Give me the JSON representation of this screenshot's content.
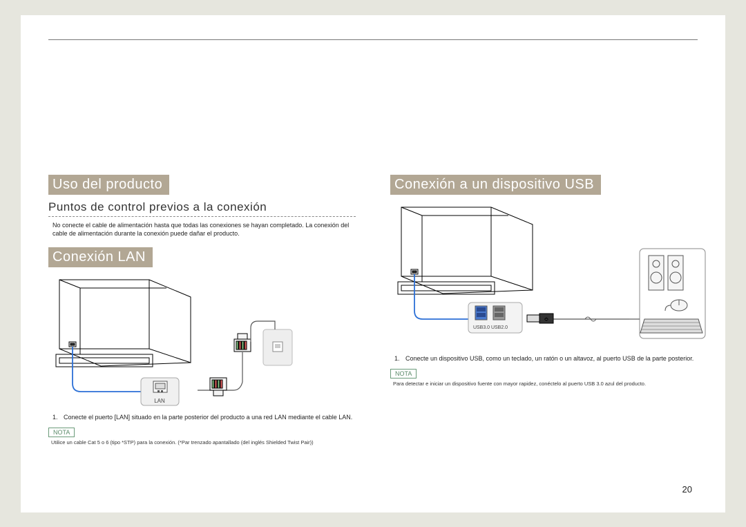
{
  "left": {
    "h1": "Uso del producto",
    "sub": "Puntos de control previos a la conexión",
    "warn": "No conecte el cable de alimentación hasta que todas las conexiones se hayan completado. La conexión del cable de alimentación durante la conexión puede dañar el producto.",
    "h2": "Conexión LAN",
    "lanLabel": "LAN",
    "step_num": "1.",
    "step": "Conecte el puerto [LAN] situado en la parte posterior del producto a una red LAN mediante el cable LAN.",
    "nota": "NOTA",
    "note": "Utilice un cable Cat 5 o 6 (tipo *STP) para la conexión. (*Par trenzado apantallado (del inglés Shielded Twist Pair))"
  },
  "right": {
    "h1": "Conexión a un dispositivo USB",
    "usb3": "USB3.0",
    "usb2": "USB2.0",
    "step_num": "1.",
    "step": "Conecte un dispositivo USB, como un teclado, un ratón o un altavoz, al puerto USB de la parte posterior.",
    "nota": "NOTA",
    "note": "Para detectar e iniciar un dispositivo fuente con mayor rapidez, conéctelo al puerto USB 3.0 azul del producto."
  },
  "page": "20"
}
